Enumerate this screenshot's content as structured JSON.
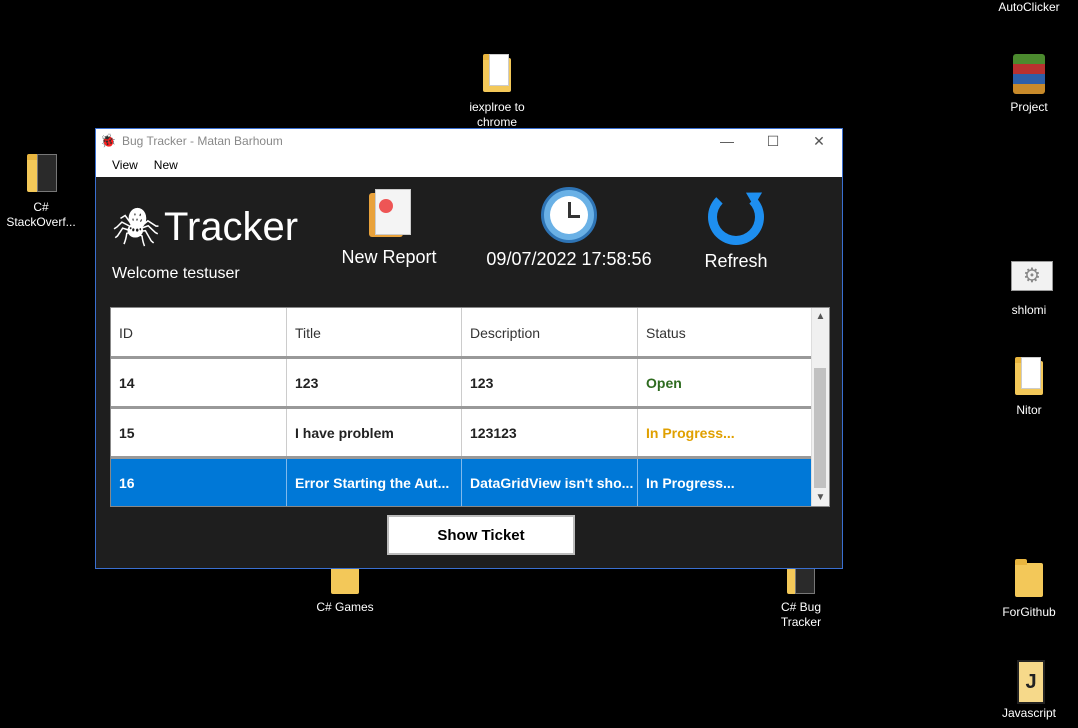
{
  "desktop": {
    "icons": [
      {
        "label": "AutoClicker"
      },
      {
        "label": "iexplroe to chrome"
      },
      {
        "label": "Project"
      },
      {
        "label": "C# StackOverf..."
      },
      {
        "label": "shlomi"
      },
      {
        "label": "Nitor"
      },
      {
        "label": "C# Games"
      },
      {
        "label": "C# Bug Tracker"
      },
      {
        "label": "ForGithub"
      },
      {
        "label": "Javascript"
      }
    ]
  },
  "window": {
    "title": "Bug Tracker - Matan Barhoum",
    "controls": {
      "minimize": "—",
      "maximize": "☐",
      "close": "✕"
    },
    "menu": [
      "View",
      "New"
    ]
  },
  "header": {
    "brand": "Tracker",
    "welcome": "Welcome testuser",
    "new_report_label": "New Report",
    "datetime": "09/07/2022 17:58:56",
    "refresh_label": "Refresh"
  },
  "grid": {
    "columns": [
      "ID",
      "Title",
      "Description",
      "Status"
    ],
    "rows": [
      {
        "id": "14",
        "title": "123",
        "description": "123",
        "status": "Open",
        "status_color": "#2e6b1f"
      },
      {
        "id": "15",
        "title": "I have problem",
        "description": "123123",
        "status": "In Progress...",
        "status_color": "#e0a000"
      },
      {
        "id": "16",
        "title": "Error Starting the Aut...",
        "description": "DataGridView isn't sho...",
        "status": "In Progress...",
        "status_color": "#ffffff"
      }
    ],
    "selected_row_index": 2,
    "scroll_up": "▲",
    "scroll_down": "▼"
  },
  "show_ticket_label": "Show Ticket",
  "colors": {
    "selection": "#0078d7",
    "window_bg": "#1e1e1e",
    "accent_blue": "#1e8ff0"
  }
}
